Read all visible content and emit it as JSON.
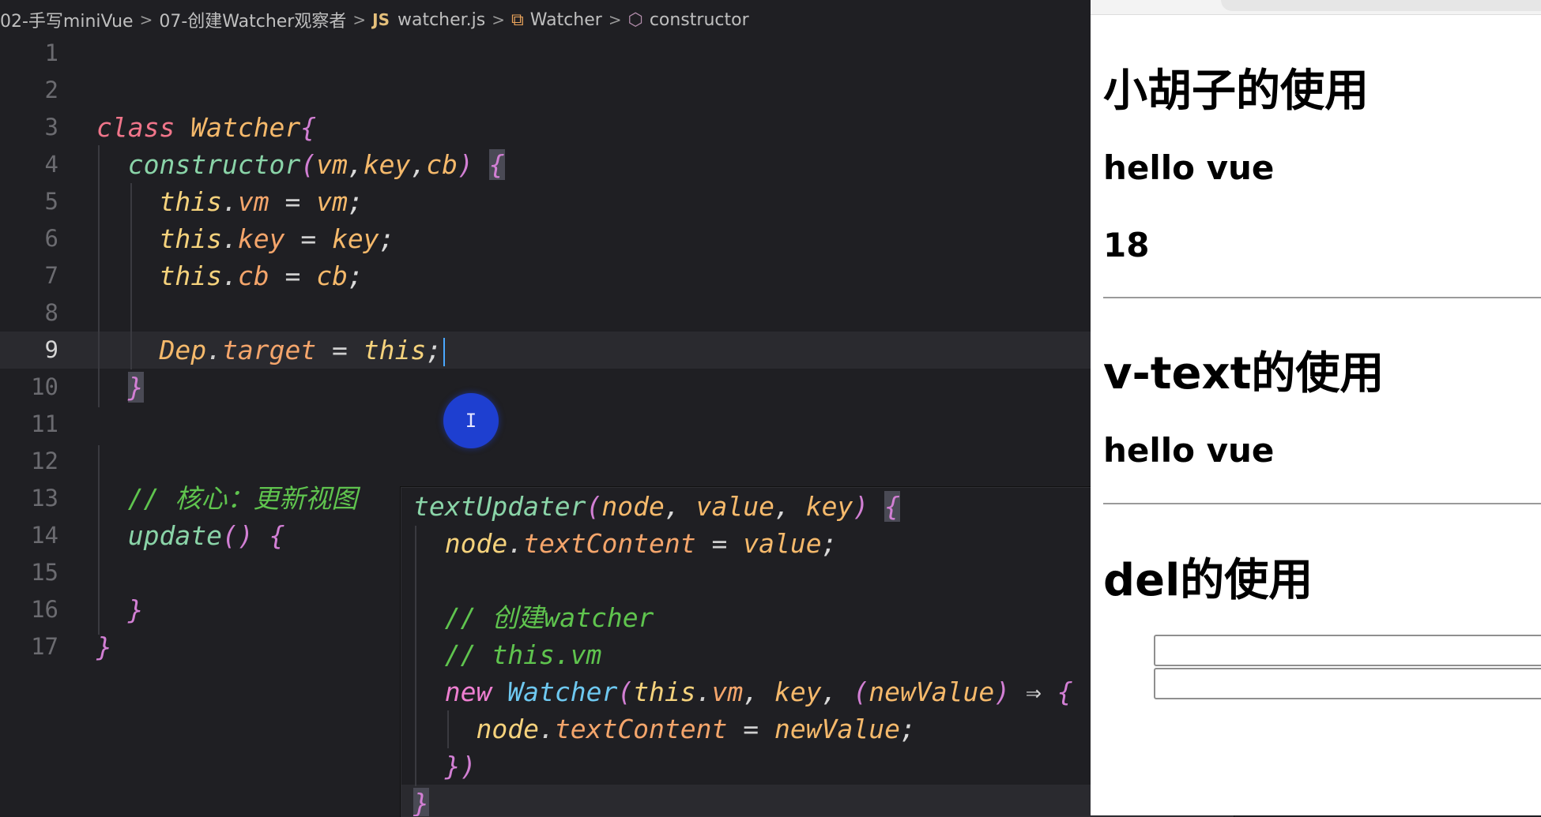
{
  "breadcrumb": {
    "folder_root": "02-手写miniVue",
    "folder": "07-创建Watcher观察者",
    "file_badge": "JS",
    "file": "watcher.js",
    "class_name": "Watcher",
    "method_name": "constructor",
    "separator": ">"
  },
  "editor": {
    "active_line": 9,
    "lines": [
      {
        "n": "1",
        "parts": []
      },
      {
        "n": "2",
        "parts": []
      },
      {
        "n": "3",
        "parts": [
          [
            "kw",
            "class"
          ],
          [
            "punc",
            " "
          ],
          [
            "cls",
            "Watcher"
          ],
          [
            "brace",
            "{"
          ]
        ]
      },
      {
        "n": "4",
        "parts": [
          [
            "punc",
            "  "
          ],
          [
            "fn",
            "constructor"
          ],
          [
            "brace",
            "("
          ],
          [
            "param",
            "vm"
          ],
          [
            "punc",
            ","
          ],
          [
            "param",
            "key"
          ],
          [
            "punc",
            ","
          ],
          [
            "param",
            "cb"
          ],
          [
            "brace",
            ")"
          ],
          [
            "punc",
            " "
          ],
          [
            "brace-hl",
            "{"
          ]
        ]
      },
      {
        "n": "5",
        "parts": [
          [
            "punc",
            "    "
          ],
          [
            "thisc",
            "this"
          ],
          [
            "op",
            "."
          ],
          [
            "prop",
            "vm"
          ],
          [
            "op",
            " = "
          ],
          [
            "param",
            "vm"
          ],
          [
            "punc",
            ";"
          ]
        ]
      },
      {
        "n": "6",
        "parts": [
          [
            "punc",
            "    "
          ],
          [
            "thisc",
            "this"
          ],
          [
            "op",
            "."
          ],
          [
            "prop",
            "key"
          ],
          [
            "op",
            " = "
          ],
          [
            "param",
            "key"
          ],
          [
            "punc",
            ";"
          ]
        ]
      },
      {
        "n": "7",
        "parts": [
          [
            "punc",
            "    "
          ],
          [
            "thisc",
            "this"
          ],
          [
            "op",
            "."
          ],
          [
            "prop",
            "cb"
          ],
          [
            "op",
            " = "
          ],
          [
            "param",
            "cb"
          ],
          [
            "punc",
            ";"
          ]
        ]
      },
      {
        "n": "8",
        "parts": []
      },
      {
        "n": "9",
        "parts": [
          [
            "punc",
            "    "
          ],
          [
            "cls",
            "Dep"
          ],
          [
            "op",
            "."
          ],
          [
            "prop",
            "target"
          ],
          [
            "op",
            " = "
          ],
          [
            "thisc",
            "this"
          ],
          [
            "punc",
            ";"
          ]
        ]
      },
      {
        "n": "10",
        "parts": [
          [
            "punc",
            "  "
          ],
          [
            "brace-hl",
            "}"
          ]
        ]
      },
      {
        "n": "11",
        "parts": []
      },
      {
        "n": "12",
        "parts": []
      },
      {
        "n": "13",
        "parts": [
          [
            "punc",
            "  "
          ],
          [
            "comment",
            "// 核心：更新视图"
          ]
        ]
      },
      {
        "n": "14",
        "parts": [
          [
            "punc",
            "  "
          ],
          [
            "fn",
            "update"
          ],
          [
            "brace",
            "()"
          ],
          [
            "punc",
            " "
          ],
          [
            "brace",
            "{"
          ]
        ]
      },
      {
        "n": "15",
        "parts": []
      },
      {
        "n": "16",
        "parts": [
          [
            "punc",
            "  "
          ],
          [
            "brace",
            "}"
          ]
        ]
      },
      {
        "n": "17",
        "parts": [
          [
            "brace",
            "}"
          ]
        ]
      }
    ]
  },
  "overlay": {
    "lines": [
      {
        "parts": [
          [
            "fn",
            "textUpdater"
          ],
          [
            "brace",
            "("
          ],
          [
            "param",
            "node"
          ],
          [
            "punc",
            ", "
          ],
          [
            "param",
            "value"
          ],
          [
            "punc",
            ", "
          ],
          [
            "param",
            "key"
          ],
          [
            "brace",
            ")"
          ],
          [
            "punc",
            " "
          ],
          [
            "brace-hl",
            "{"
          ]
        ]
      },
      {
        "parts": [
          [
            "punc",
            "  "
          ],
          [
            "thisc",
            "node"
          ],
          [
            "op",
            "."
          ],
          [
            "prop",
            "textContent"
          ],
          [
            "op",
            " = "
          ],
          [
            "param",
            "value"
          ],
          [
            "punc",
            ";"
          ]
        ]
      },
      {
        "parts": []
      },
      {
        "parts": [
          [
            "punc",
            "  "
          ],
          [
            "comment",
            "// 创建watcher"
          ]
        ]
      },
      {
        "parts": [
          [
            "punc",
            "  "
          ],
          [
            "comment",
            "// this.vm"
          ]
        ]
      },
      {
        "parts": [
          [
            "punc",
            "  "
          ],
          [
            "newkw",
            "new"
          ],
          [
            "punc",
            " "
          ],
          [
            "clsblue",
            "Watcher"
          ],
          [
            "brace",
            "("
          ],
          [
            "thisc",
            "this"
          ],
          [
            "op",
            "."
          ],
          [
            "prop",
            "vm"
          ],
          [
            "punc",
            ", "
          ],
          [
            "param",
            "key"
          ],
          [
            "punc",
            ", "
          ],
          [
            "brace",
            "("
          ],
          [
            "param",
            "newValue"
          ],
          [
            "brace",
            ")"
          ],
          [
            "op",
            " ⇒ "
          ],
          [
            "brace",
            "{"
          ]
        ]
      },
      {
        "parts": [
          [
            "punc",
            "    "
          ],
          [
            "thisc",
            "node"
          ],
          [
            "op",
            "."
          ],
          [
            "prop",
            "textContent"
          ],
          [
            "op",
            " = "
          ],
          [
            "param",
            "newValue"
          ],
          [
            "punc",
            ";"
          ]
        ]
      },
      {
        "parts": [
          [
            "punc",
            "  "
          ],
          [
            "brace",
            "})"
          ]
        ]
      },
      {
        "parts": [
          [
            "brace-hl",
            "}"
          ]
        ]
      }
    ]
  },
  "browser": {
    "heading_mustache": "小胡子的使用",
    "mustache_text": "hello vue",
    "mustache_number": "18",
    "heading_vtext": "v-text的使用",
    "vtext_text": "hello vue",
    "heading_vmodel_visible": "del的使用"
  }
}
